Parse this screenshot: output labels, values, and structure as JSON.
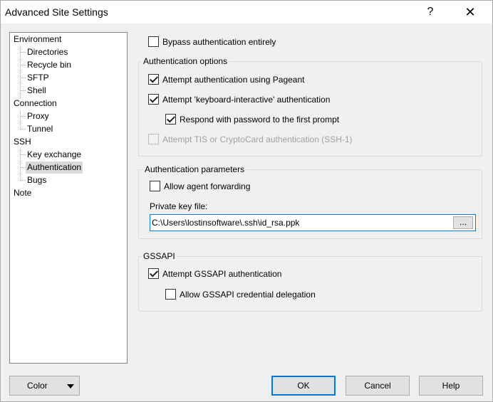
{
  "window": {
    "title": "Advanced Site Settings",
    "help_glyph": "?",
    "close_glyph": "✕"
  },
  "tree": {
    "items": [
      {
        "label": "Environment"
      },
      {
        "label": "Directories"
      },
      {
        "label": "Recycle bin"
      },
      {
        "label": "SFTP"
      },
      {
        "label": "Shell"
      },
      {
        "label": "Connection"
      },
      {
        "label": "Proxy"
      },
      {
        "label": "Tunnel"
      },
      {
        "label": "SSH"
      },
      {
        "label": "Key exchange"
      },
      {
        "label": "Authentication"
      },
      {
        "label": "Bugs"
      },
      {
        "label": "Note"
      }
    ]
  },
  "bypass": {
    "label": "Bypass authentication entirely",
    "checked": false
  },
  "auth_options": {
    "title": "Authentication options",
    "pageant": {
      "label": "Attempt authentication using Pageant",
      "checked": true
    },
    "keyboard_interactive": {
      "label": "Attempt 'keyboard-interactive' authentication",
      "checked": true
    },
    "respond_password": {
      "label": "Respond with password to the first prompt",
      "checked": true
    },
    "tis": {
      "label": "Attempt TIS or CryptoCard authentication (SSH-1)",
      "checked": false,
      "disabled": true
    }
  },
  "auth_params": {
    "title": "Authentication parameters",
    "agent_forwarding": {
      "label": "Allow agent forwarding",
      "checked": false
    },
    "private_key_label": "Private key file:",
    "private_key_value": "C:\\Users\\lostinsoftware\\.ssh\\id_rsa.ppk",
    "browse_label": "..."
  },
  "gssapi": {
    "title": "GSSAPI",
    "attempt": {
      "label": "Attempt GSSAPI authentication",
      "checked": true
    },
    "delegation": {
      "label": "Allow GSSAPI credential delegation",
      "checked": false
    }
  },
  "buttons": {
    "color": "Color",
    "ok": "OK",
    "cancel": "Cancel",
    "help": "Help"
  }
}
